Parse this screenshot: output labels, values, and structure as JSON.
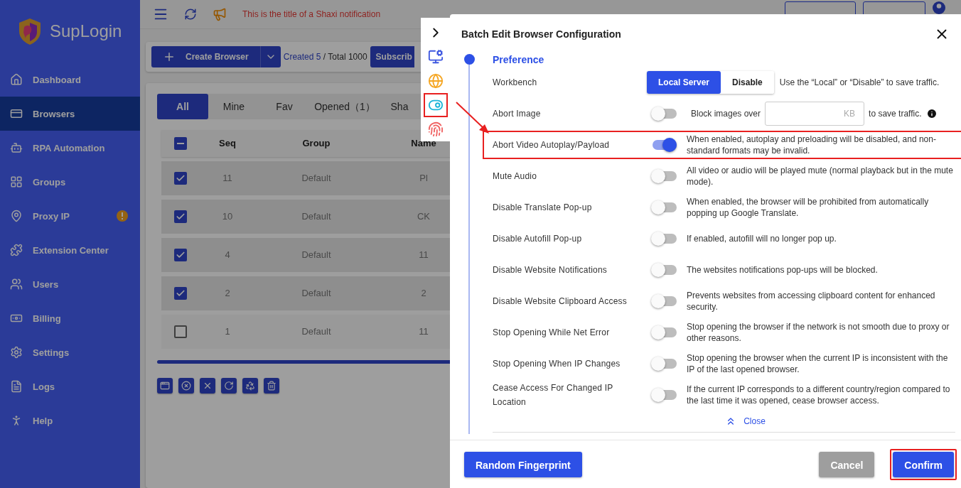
{
  "brand": "SupLogin",
  "sidebar": {
    "items": [
      {
        "label": "Dashboard",
        "selected": false
      },
      {
        "label": "Browsers",
        "selected": true
      },
      {
        "label": "RPA Automation",
        "selected": false
      },
      {
        "label": "Groups",
        "selected": false
      },
      {
        "label": "Proxy IP",
        "selected": false,
        "warning": true
      },
      {
        "label": "Extension Center",
        "selected": false
      },
      {
        "label": "Users",
        "selected": false
      },
      {
        "label": "Billing",
        "selected": false
      },
      {
        "label": "Settings",
        "selected": false
      },
      {
        "label": "Logs",
        "selected": false
      },
      {
        "label": "Help",
        "selected": false
      }
    ]
  },
  "header": {
    "notification": "This is the title of a Shaxi notification"
  },
  "toolbar": {
    "create": "Create Browser",
    "created": "Created 5",
    "total": " / Total 1000",
    "subscribe": "Subscrib"
  },
  "tabs": [
    {
      "label": "All",
      "selected": true
    },
    {
      "label": "Mine",
      "selected": false
    },
    {
      "label": "Fav",
      "selected": false
    },
    {
      "label": "Opened（1）",
      "selected": false
    },
    {
      "label": "Sha",
      "selected": false
    }
  ],
  "table": {
    "select_all": {
      "indeterminate": true
    },
    "columns": [
      "Seq",
      "Group",
      "Name"
    ],
    "rows": [
      {
        "checked": true,
        "cells": [
          "11",
          "Default",
          "Pl"
        ]
      },
      {
        "checked": true,
        "cells": [
          "10",
          "Default",
          "CK"
        ]
      },
      {
        "checked": true,
        "cells": [
          "4",
          "Default",
          "11"
        ]
      },
      {
        "checked": true,
        "cells": [
          "2",
          "Default",
          "2"
        ]
      },
      {
        "checked": false,
        "cells": [
          "1",
          "Default",
          "11"
        ]
      }
    ]
  },
  "side_tools": [
    {
      "highlighted": false
    },
    {
      "highlighted": false
    },
    {
      "highlighted": false
    },
    {
      "highlighted": true
    },
    {
      "highlighted": false
    }
  ],
  "dialog": {
    "title": "Batch Edit Browser Configuration",
    "section": "Preference",
    "settings": [
      {
        "kind": "segment",
        "label": "Workbench",
        "highlighted": false,
        "options": [
          {
            "label": "Local Server",
            "selected": true
          },
          {
            "label": "Disable",
            "selected": false
          }
        ],
        "description": "Use the “Local” or “Disable” to save traffic."
      },
      {
        "kind": "threshold",
        "label": "Abort Image",
        "highlighted": false,
        "on": false,
        "prefix": "Block images over",
        "unit": "KB",
        "suffix": "to save traffic."
      },
      {
        "kind": "toggle",
        "label": "Abort Video Autoplay/Payload",
        "highlighted": true,
        "on": true,
        "description": "When enabled, autoplay and preloading will be disabled, and non-standard formats may be invalid."
      },
      {
        "kind": "toggle",
        "label": "Mute Audio",
        "highlighted": false,
        "on": false,
        "description": "All video or audio will be played mute (normal playback but in the mute mode)."
      },
      {
        "kind": "toggle",
        "label": "Disable Translate Pop-up",
        "highlighted": false,
        "on": false,
        "description": "When enabled, the browser will be prohibited from automatically popping up Google Translate."
      },
      {
        "kind": "toggle",
        "label": "Disable Autofill Pop-up",
        "highlighted": false,
        "on": false,
        "description": "If enabled, autofill will no longer pop up."
      },
      {
        "kind": "toggle",
        "label": "Disable Website Notifications",
        "highlighted": false,
        "on": false,
        "description": "The websites notifications pop-ups will be blocked."
      },
      {
        "kind": "toggle",
        "label": "Disable Website Clipboard Access",
        "highlighted": false,
        "on": false,
        "description": "Prevents websites from accessing clipboard content for enhanced security."
      },
      {
        "kind": "toggle",
        "label": "Stop Opening While Net Error",
        "highlighted": false,
        "on": false,
        "description": "Stop opening the browser if the network is not smooth due to proxy or other reasons."
      },
      {
        "kind": "toggle",
        "label": "Stop Opening When IP Changes",
        "highlighted": false,
        "on": false,
        "description": "Stop opening the browser when the current IP is inconsistent with the IP of the last opened browser."
      },
      {
        "kind": "toggle",
        "label": "Cease Access For Changed IP Location",
        "highlighted": false,
        "on": false,
        "description": "If the current IP corresponds to a different country/region compared to the last time it was opened, cease browser access."
      }
    ],
    "collapse": "Close",
    "buttons": [
      {
        "label": "Random Fingerprint",
        "kind": "primary",
        "highlighted": false
      },
      {
        "label": "Cancel",
        "kind": "secondary",
        "highlighted": false
      },
      {
        "label": "Confirm",
        "kind": "primary",
        "highlighted": true
      }
    ]
  }
}
